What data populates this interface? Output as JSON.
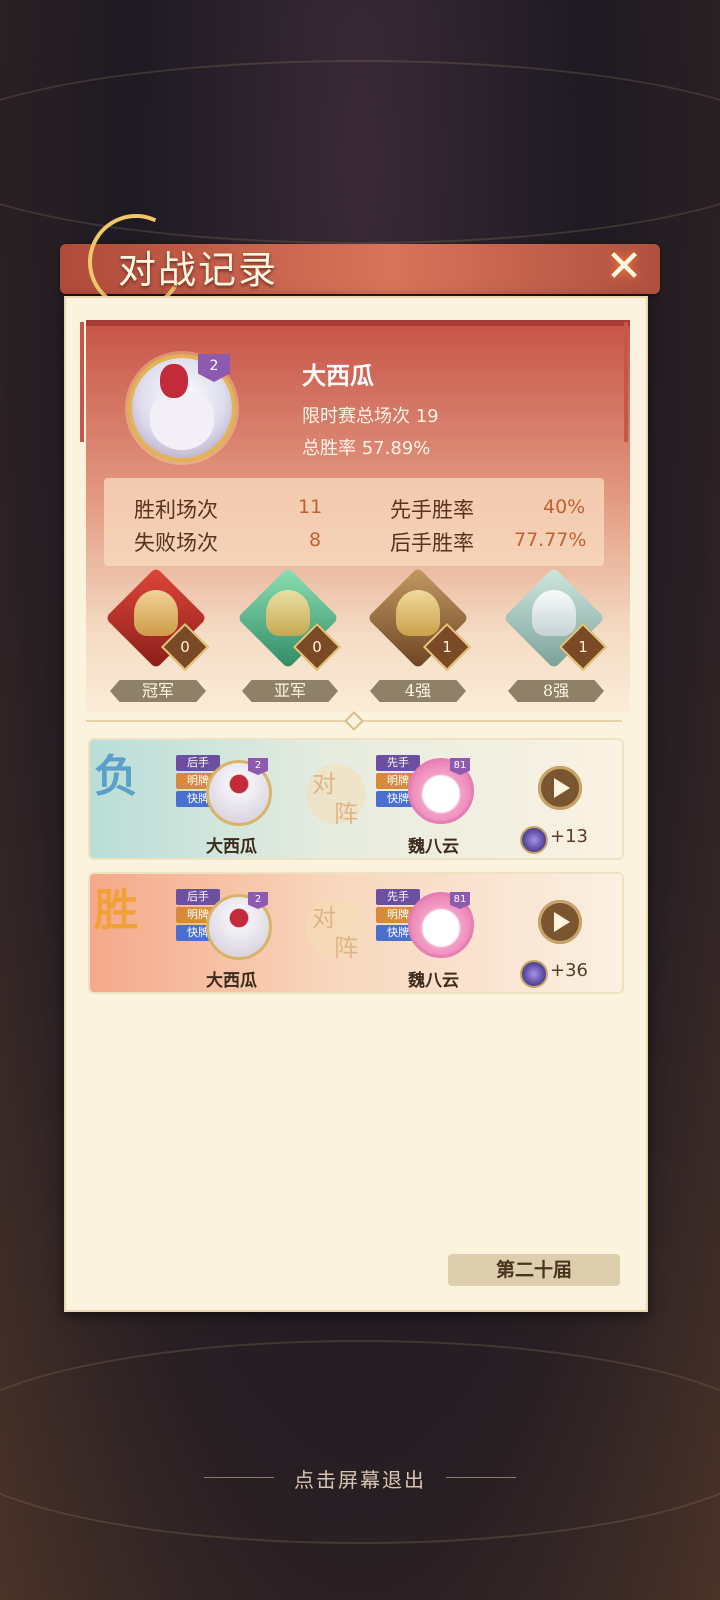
{
  "dialog": {
    "title": "对战记录",
    "close_icon": "close-x-icon"
  },
  "profile": {
    "name": "大西瓜",
    "level": "2",
    "total_matches_text": "限时赛总场次  19",
    "win_rate_text": "总胜率  57.89%"
  },
  "stats": {
    "wins_label": "胜利场次",
    "wins_value": "11",
    "losses_label": "失败场次",
    "losses_value": "8",
    "first_hand_label": "先手胜率",
    "first_hand_value": "40%",
    "second_hand_label": "后手胜率",
    "second_hand_value": "77.77%"
  },
  "trophies": [
    {
      "label": "冠军",
      "count": "0",
      "color": "#c23a2e"
    },
    {
      "label": "亚军",
      "count": "0",
      "color": "#3fa07a"
    },
    {
      "label": "4强",
      "count": "1",
      "color": "#8a5a2e"
    },
    {
      "label": "8强",
      "count": "1",
      "color": "#9bbfb6"
    }
  ],
  "records": [
    {
      "result": "负",
      "result_color": "#5aa0c8",
      "player1": {
        "name": "大西瓜",
        "level": "2",
        "tags": [
          "后手",
          "明牌",
          "快牌"
        ]
      },
      "vs_a": "对",
      "vs_b": "阵",
      "player2": {
        "name": "魏八云",
        "level": "81",
        "tags": [
          "先手",
          "明牌",
          "快牌"
        ]
      },
      "score": "+13"
    },
    {
      "result": "胜",
      "result_color": "#f0a238",
      "player1": {
        "name": "大西瓜",
        "level": "2",
        "tags": [
          "后手",
          "明牌",
          "快牌"
        ]
      },
      "vs_a": "对",
      "vs_b": "阵",
      "player2": {
        "name": "魏八云",
        "level": "81",
        "tags": [
          "先手",
          "明牌",
          "快牌"
        ]
      },
      "score": "+36"
    }
  ],
  "season_label": "第二十届",
  "exit_hint": "点击屏幕退出"
}
